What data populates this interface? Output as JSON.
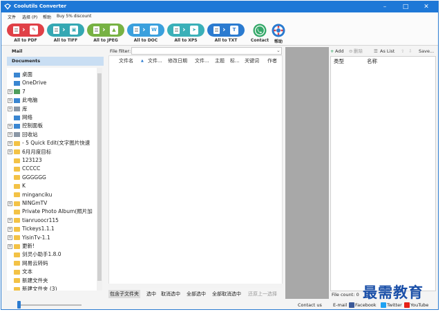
{
  "window": {
    "title": "Coolutils Converter"
  },
  "menu": {
    "items": [
      "文件",
      "选择 (P)",
      "帮助",
      "Buy 5% discount"
    ]
  },
  "converters": [
    {
      "label": "All to PDF",
      "color": "#e04047",
      "target": "✎"
    },
    {
      "label": "All to TIFF",
      "color": "#35a8b3",
      "target": "▣"
    },
    {
      "label": "All to JPEG",
      "color": "#77b243",
      "target": "▲"
    },
    {
      "label": "All to DOC",
      "color": "#3aa0dd",
      "target": "W"
    },
    {
      "label": "All to XPS",
      "color": "#3ab0b8",
      "target": "➤"
    },
    {
      "label": "All to TXT",
      "color": "#2b7bd0",
      "target": "T"
    }
  ],
  "contact": {
    "label": "Contact",
    "color": "#36a96a"
  },
  "help": {
    "label": "帮助",
    "color": "#2b7bd0"
  },
  "nav": {
    "mail": "Mail",
    "documents": "Documents"
  },
  "tree": [
    {
      "label": "桌面",
      "icon": "desktop-icon",
      "exp": ""
    },
    {
      "label": "OneDrive",
      "icon": "cloud-icon",
      "exp": ""
    },
    {
      "label": "7",
      "icon": "user-icon",
      "exp": "+"
    },
    {
      "label": "此电脑",
      "icon": "computer-icon",
      "exp": "+"
    },
    {
      "label": "库",
      "icon": "library-icon",
      "exp": "+"
    },
    {
      "label": "网络",
      "icon": "network-icon",
      "exp": ""
    },
    {
      "label": "控制面板",
      "icon": "control-panel-icon",
      "exp": "+"
    },
    {
      "label": "回收站",
      "icon": "recycle-bin-icon",
      "exp": "+"
    },
    {
      "label": "- 5 Quick Edit(文字图片快速",
      "icon": "folder-icon",
      "exp": "+"
    },
    {
      "label": "6月月度目标",
      "icon": "folder-icon",
      "exp": "+"
    },
    {
      "label": "123123",
      "icon": "folder-icon",
      "exp": ""
    },
    {
      "label": "CCCCC",
      "icon": "folder-icon",
      "exp": ""
    },
    {
      "label": "GGGGGG",
      "icon": "folder-icon",
      "exp": ""
    },
    {
      "label": "K",
      "icon": "folder-icon",
      "exp": ""
    },
    {
      "label": "minganciku",
      "icon": "folder-icon",
      "exp": ""
    },
    {
      "label": "NINGmTV",
      "icon": "folder-icon",
      "exp": "+"
    },
    {
      "label": "Private Photo Album(照片加",
      "icon": "folder-icon",
      "exp": ""
    },
    {
      "label": "tianruoocr115",
      "icon": "folder-icon",
      "exp": "+"
    },
    {
      "label": "Tickeys1.1.1",
      "icon": "folder-icon",
      "exp": "+"
    },
    {
      "label": "YisinTv-1.1",
      "icon": "folder-icon",
      "exp": "+"
    },
    {
      "label": "更新!",
      "icon": "folder-icon",
      "exp": "+"
    },
    {
      "label": "剑灵小助手1.8.0",
      "icon": "folder-icon",
      "exp": ""
    },
    {
      "label": "网易云转码",
      "icon": "folder-icon",
      "exp": ""
    },
    {
      "label": "文本",
      "icon": "folder-icon",
      "exp": ""
    },
    {
      "label": "新建文件夹",
      "icon": "folder-icon",
      "exp": ""
    },
    {
      "label": "新建文件夹 (3)",
      "icon": "folder-icon",
      "exp": ""
    }
  ],
  "filter": {
    "label": "File filter:",
    "value": ""
  },
  "file_list": {
    "columns": [
      "文件名",
      "文件...",
      "修改日期",
      "文件...",
      "主题",
      "标...",
      "关键词",
      "作者"
    ]
  },
  "bottom_tabs": [
    "包含子文件夹",
    "选中",
    "取消选中",
    "全部选中",
    "全部取消选中",
    "还原上一选择"
  ],
  "right_toolbar": {
    "add": "Add",
    "delete": "删除",
    "as_list": "As List",
    "save": "Save..."
  },
  "props": {
    "columns": [
      "类型",
      "名称"
    ]
  },
  "file_count": {
    "label": "File count:",
    "value": "0"
  },
  "status": {
    "contact": "Contact us",
    "email": "E-mail",
    "facebook": "Facebook",
    "twitter": "Twitter",
    "youtube": "YouTube"
  },
  "watermark": "最需教育"
}
